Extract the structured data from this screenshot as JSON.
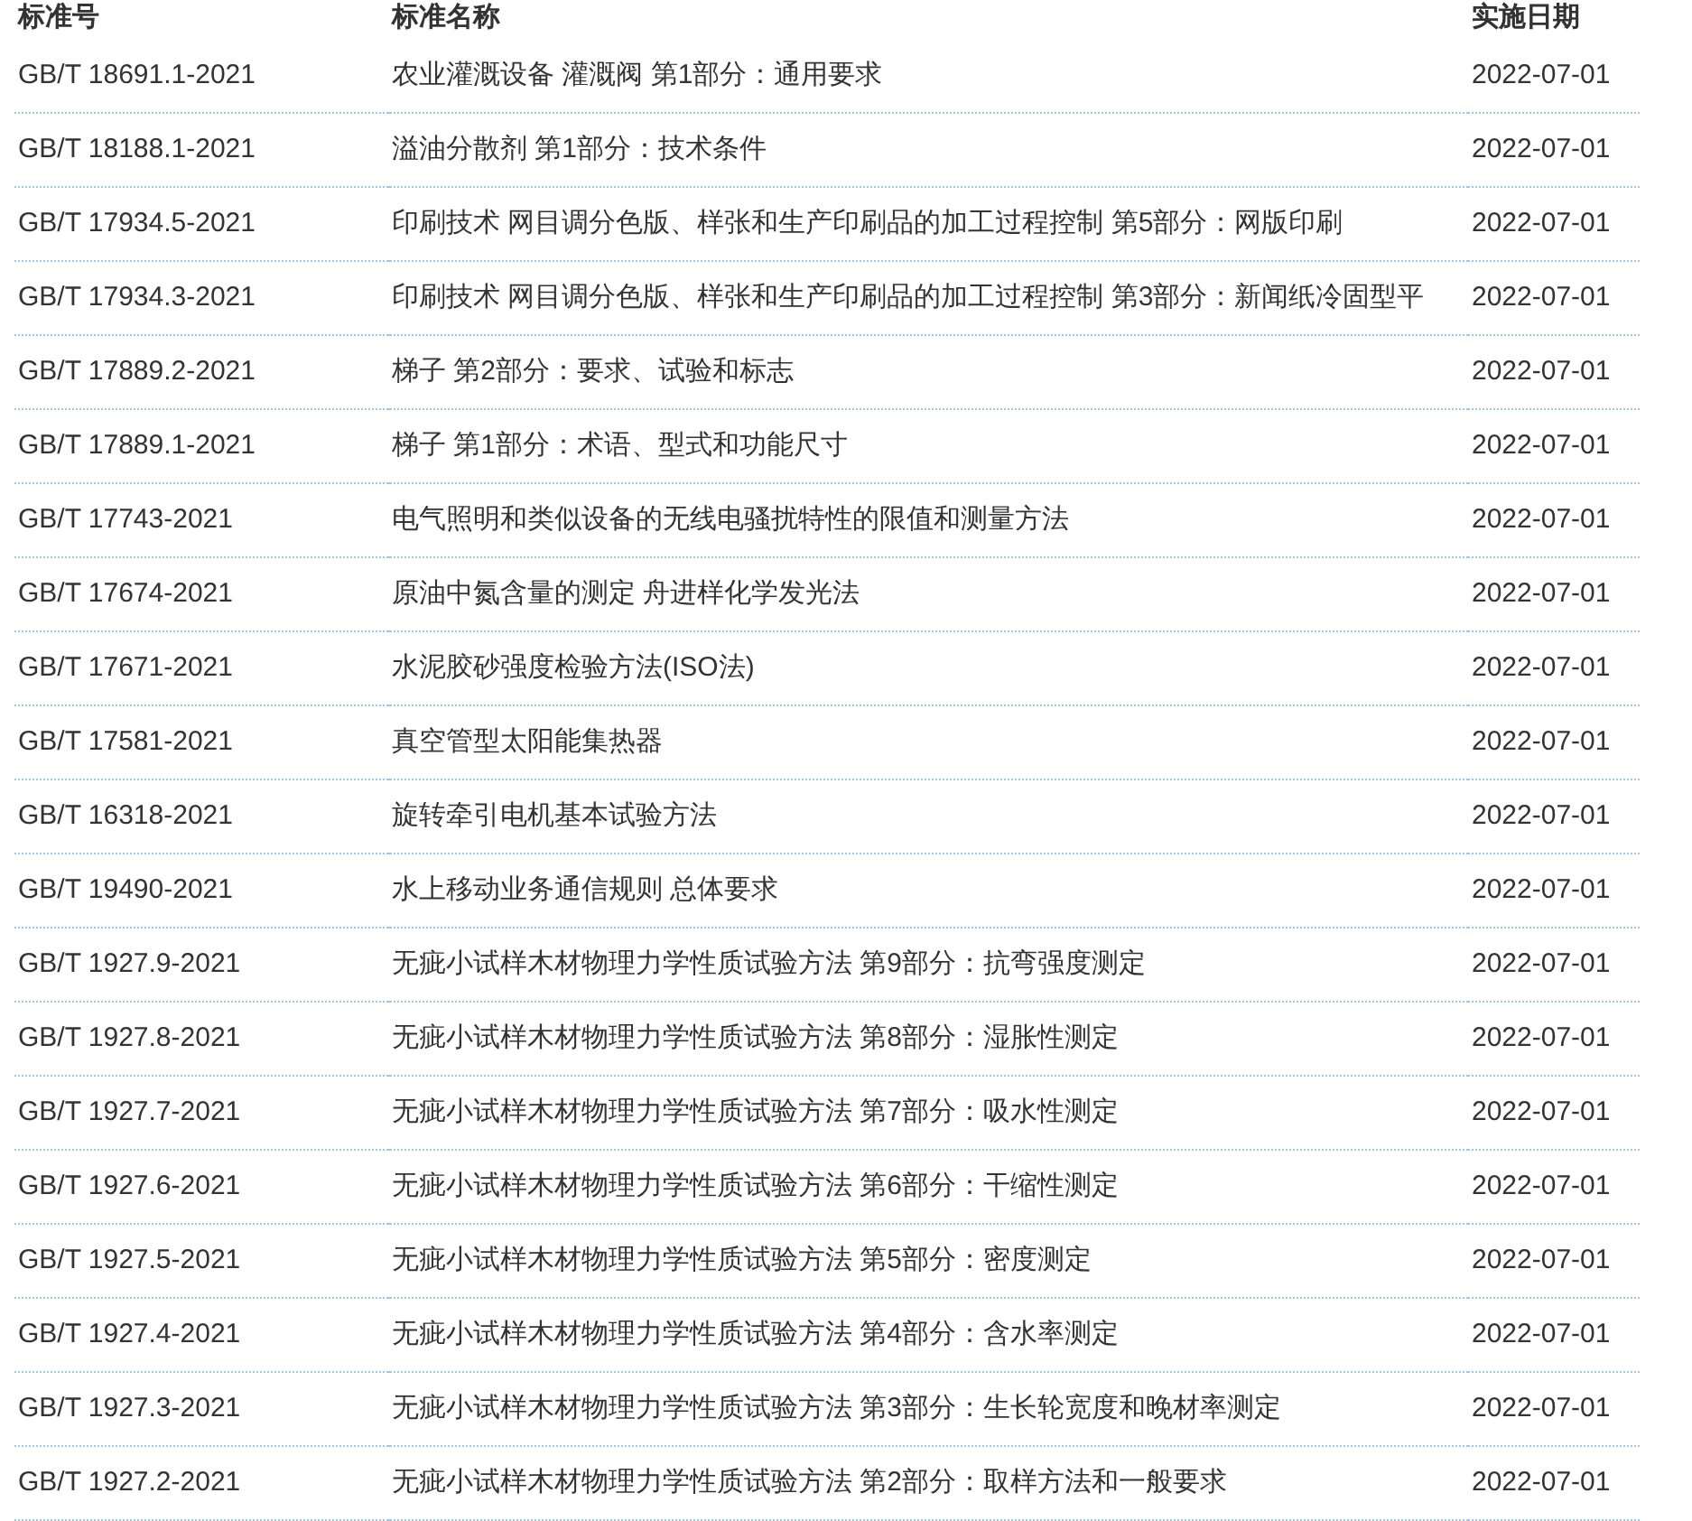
{
  "table": {
    "columns": [
      "标准号",
      "标准名称",
      "实施日期"
    ],
    "rows": [
      {
        "code": "GB/T 18691.1-2021",
        "name": "农业灌溉设备 灌溉阀 第1部分：通用要求",
        "date": "2022-07-01"
      },
      {
        "code": "GB/T 18188.1-2021",
        "name": "溢油分散剂 第1部分：技术条件",
        "date": "2022-07-01"
      },
      {
        "code": "GB/T 17934.5-2021",
        "name": "印刷技术 网目调分色版、样张和生产印刷品的加工过程控制 第5部分：网版印刷",
        "date": "2022-07-01"
      },
      {
        "code": "GB/T 17934.3-2021",
        "name": "印刷技术 网目调分色版、样张和生产印刷品的加工过程控制 第3部分：新闻纸冷固型平",
        "date": "2022-07-01"
      },
      {
        "code": "GB/T 17889.2-2021",
        "name": "梯子 第2部分：要求、试验和标志",
        "date": "2022-07-01"
      },
      {
        "code": "GB/T 17889.1-2021",
        "name": "梯子 第1部分：术语、型式和功能尺寸",
        "date": "2022-07-01"
      },
      {
        "code": "GB/T 17743-2021",
        "name": "电气照明和类似设备的无线电骚扰特性的限值和测量方法",
        "date": "2022-07-01"
      },
      {
        "code": "GB/T 17674-2021",
        "name": "原油中氮含量的测定 舟进样化学发光法",
        "date": "2022-07-01"
      },
      {
        "code": "GB/T 17671-2021",
        "name": "水泥胶砂强度检验方法(ISO法)",
        "date": "2022-07-01"
      },
      {
        "code": "GB/T 17581-2021",
        "name": "真空管型太阳能集热器",
        "date": "2022-07-01"
      },
      {
        "code": "GB/T 16318-2021",
        "name": "旋转牵引电机基本试验方法",
        "date": "2022-07-01"
      },
      {
        "code": "GB/T 19490-2021",
        "name": "水上移动业务通信规则 总体要求",
        "date": "2022-07-01"
      },
      {
        "code": "GB/T 1927.9-2021",
        "name": "无疵小试样木材物理力学性质试验方法 第9部分：抗弯强度测定",
        "date": "2022-07-01"
      },
      {
        "code": "GB/T 1927.8-2021",
        "name": "无疵小试样木材物理力学性质试验方法 第8部分：湿胀性测定",
        "date": "2022-07-01"
      },
      {
        "code": "GB/T 1927.7-2021",
        "name": "无疵小试样木材物理力学性质试验方法 第7部分：吸水性测定",
        "date": "2022-07-01"
      },
      {
        "code": "GB/T 1927.6-2021",
        "name": "无疵小试样木材物理力学性质试验方法 第6部分：干缩性测定",
        "date": "2022-07-01"
      },
      {
        "code": "GB/T 1927.5-2021",
        "name": "无疵小试样木材物理力学性质试验方法 第5部分：密度测定",
        "date": "2022-07-01"
      },
      {
        "code": "GB/T 1927.4-2021",
        "name": "无疵小试样木材物理力学性质试验方法 第4部分：含水率测定",
        "date": "2022-07-01"
      },
      {
        "code": "GB/T 1927.3-2021",
        "name": "无疵小试样木材物理力学性质试验方法 第3部分：生长轮宽度和晚材率测定",
        "date": "2022-07-01"
      },
      {
        "code": "GB/T 1927.2-2021",
        "name": "无疵小试样木材物理力学性质试验方法 第2部分：取样方法和一般要求",
        "date": "2022-07-01"
      }
    ]
  }
}
